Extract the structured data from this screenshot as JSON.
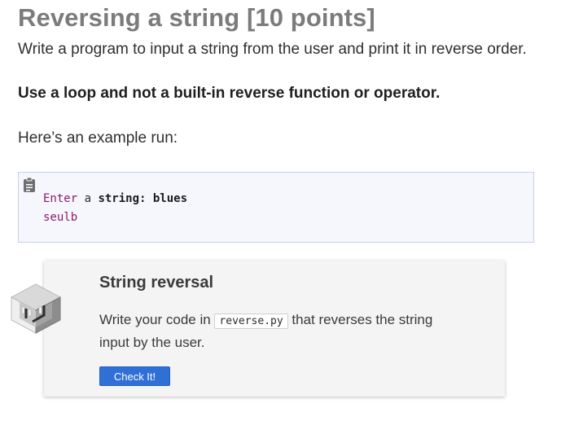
{
  "heading": "Reversing a string [10 points]",
  "intro": "Write a program to input a string from the user and print it in reverse order.",
  "rule": "Use a loop and not a built-in reverse function or operator.",
  "example_label": "Here’s an example run:",
  "code_block": {
    "icon": "clipboard-icon",
    "line1": {
      "keyword": "Enter",
      "plain": " a ",
      "prompt": "string: blues"
    },
    "line2": "seulb"
  },
  "card": {
    "icon": "isometric-cube-icon",
    "title": "String reversal",
    "text_before": "Write your code in ",
    "filename": "reverse.py",
    "text_after": " that reverses the string input by the user.",
    "button_label": "Check It!"
  },
  "colors": {
    "heading": "#7b7b7b",
    "code_keyword": "#8a1b6b",
    "code_background": "#f6f7fc",
    "card_background": "#f3f4f3",
    "button": "#2f6fd6"
  }
}
